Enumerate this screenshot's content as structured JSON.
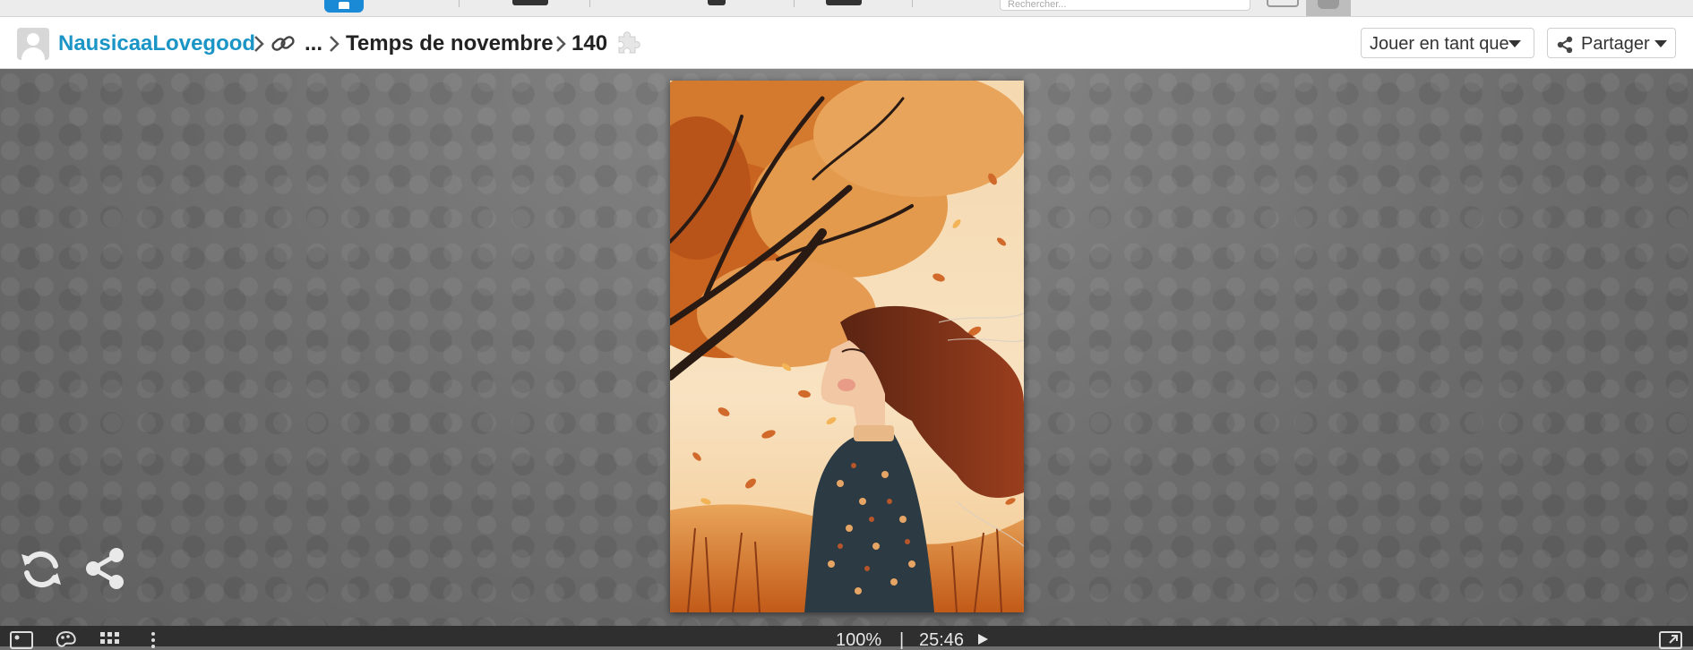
{
  "topnav": {
    "search_placeholder": "Rechercher...",
    "colors": {
      "logo": "#1a8ad6"
    }
  },
  "breadcrumb": {
    "user": "NausicaaLovegood",
    "ellipsis": "...",
    "album": "Temps de novembre",
    "piece_count": "140",
    "icons": [
      "avatar",
      "link-icon",
      "chevron-right-icon",
      "puzzle-piece-icon"
    ]
  },
  "actions": {
    "play_as": "Jouer en tant que",
    "share": "Partager"
  },
  "stage": {
    "image_subject": "puzzle-image",
    "tools": [
      "refresh-icon",
      "share-icon"
    ]
  },
  "statusbar": {
    "zoom": "100%",
    "separator": "|",
    "timer": "25:46",
    "icons": [
      "image-icon",
      "palette-icon",
      "grid-icon",
      "more-vert-icon",
      "play-icon",
      "fullscreen-icon"
    ]
  },
  "colors": {
    "accent": "#1a95c6",
    "background": "#6e6e6e",
    "bar": "#2f2f2f"
  }
}
